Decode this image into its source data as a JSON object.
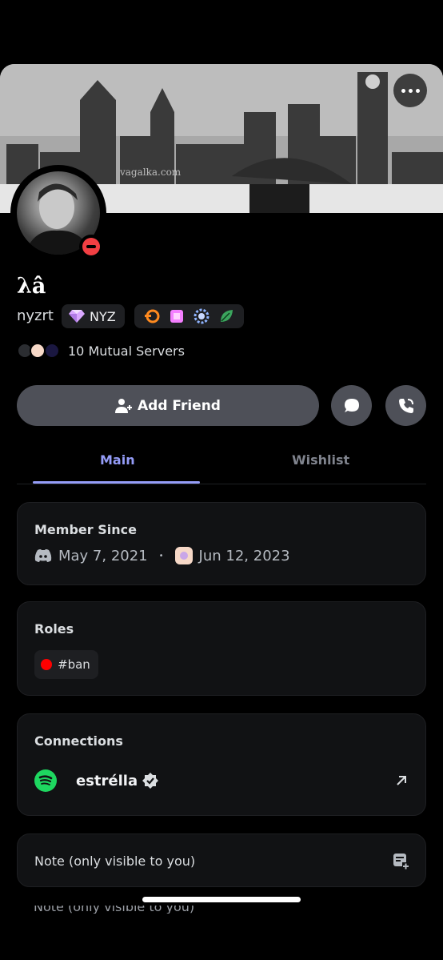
{
  "banner": {
    "watermark": "vagalka.com"
  },
  "profile": {
    "display_name": "λâ",
    "username": "nyzrt",
    "server_tag": "NYZ",
    "status": "do-not-disturb",
    "badges": [
      "orange-quest-badge",
      "pink-nitro-badge",
      "hypesquad-badge",
      "leaf-badge"
    ]
  },
  "mutual": {
    "label": "10 Mutual Servers"
  },
  "actions": {
    "add_friend_label": "Add Friend",
    "message_icon": "chat-bubble-icon",
    "call_icon": "phone-icon"
  },
  "tabs": [
    {
      "label": "Main",
      "active": true
    },
    {
      "label": "Wishlist",
      "active": false
    }
  ],
  "member_since": {
    "title": "Member Since",
    "discord_date": "May 7, 2021",
    "server_date": "Jun 12, 2023",
    "separator": "•"
  },
  "roles": {
    "title": "Roles",
    "items": [
      {
        "name": "#ban",
        "color": "#ff0000"
      }
    ]
  },
  "connections": {
    "title": "Connections",
    "items": [
      {
        "service": "spotify",
        "name": "estrélla",
        "verified": true
      }
    ]
  },
  "note": {
    "placeholder": "Note (only visible to you)"
  },
  "colors": {
    "accent": "#949cf7",
    "background": "#000000",
    "card": "#111214",
    "button": "#4e5058",
    "dnd": "#f23f43",
    "spotify": "#1ed760"
  }
}
